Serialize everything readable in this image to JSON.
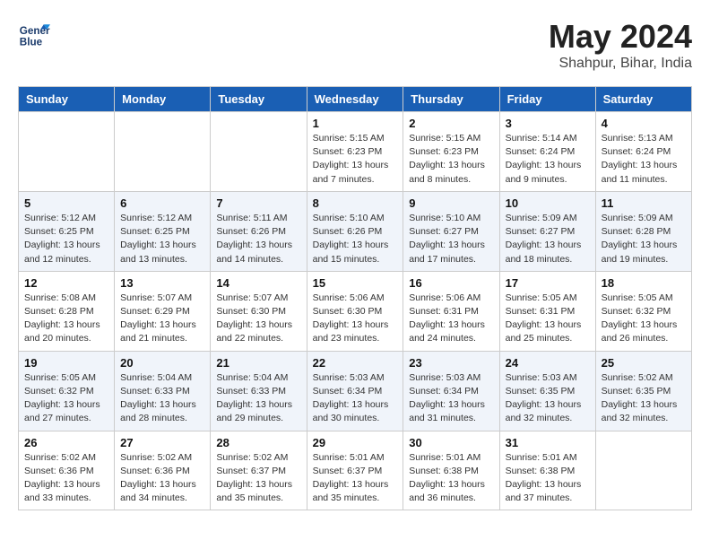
{
  "header": {
    "logo_line1": "General",
    "logo_line2": "Blue",
    "month_title": "May 2024",
    "location": "Shahpur, Bihar, India"
  },
  "weekdays": [
    "Sunday",
    "Monday",
    "Tuesday",
    "Wednesday",
    "Thursday",
    "Friday",
    "Saturday"
  ],
  "weeks": [
    [
      {
        "day": "",
        "info": ""
      },
      {
        "day": "",
        "info": ""
      },
      {
        "day": "",
        "info": ""
      },
      {
        "day": "1",
        "info": "Sunrise: 5:15 AM\nSunset: 6:23 PM\nDaylight: 13 hours\nand 7 minutes."
      },
      {
        "day": "2",
        "info": "Sunrise: 5:15 AM\nSunset: 6:23 PM\nDaylight: 13 hours\nand 8 minutes."
      },
      {
        "day": "3",
        "info": "Sunrise: 5:14 AM\nSunset: 6:24 PM\nDaylight: 13 hours\nand 9 minutes."
      },
      {
        "day": "4",
        "info": "Sunrise: 5:13 AM\nSunset: 6:24 PM\nDaylight: 13 hours\nand 11 minutes."
      }
    ],
    [
      {
        "day": "5",
        "info": "Sunrise: 5:12 AM\nSunset: 6:25 PM\nDaylight: 13 hours\nand 12 minutes."
      },
      {
        "day": "6",
        "info": "Sunrise: 5:12 AM\nSunset: 6:25 PM\nDaylight: 13 hours\nand 13 minutes."
      },
      {
        "day": "7",
        "info": "Sunrise: 5:11 AM\nSunset: 6:26 PM\nDaylight: 13 hours\nand 14 minutes."
      },
      {
        "day": "8",
        "info": "Sunrise: 5:10 AM\nSunset: 6:26 PM\nDaylight: 13 hours\nand 15 minutes."
      },
      {
        "day": "9",
        "info": "Sunrise: 5:10 AM\nSunset: 6:27 PM\nDaylight: 13 hours\nand 17 minutes."
      },
      {
        "day": "10",
        "info": "Sunrise: 5:09 AM\nSunset: 6:27 PM\nDaylight: 13 hours\nand 18 minutes."
      },
      {
        "day": "11",
        "info": "Sunrise: 5:09 AM\nSunset: 6:28 PM\nDaylight: 13 hours\nand 19 minutes."
      }
    ],
    [
      {
        "day": "12",
        "info": "Sunrise: 5:08 AM\nSunset: 6:28 PM\nDaylight: 13 hours\nand 20 minutes."
      },
      {
        "day": "13",
        "info": "Sunrise: 5:07 AM\nSunset: 6:29 PM\nDaylight: 13 hours\nand 21 minutes."
      },
      {
        "day": "14",
        "info": "Sunrise: 5:07 AM\nSunset: 6:30 PM\nDaylight: 13 hours\nand 22 minutes."
      },
      {
        "day": "15",
        "info": "Sunrise: 5:06 AM\nSunset: 6:30 PM\nDaylight: 13 hours\nand 23 minutes."
      },
      {
        "day": "16",
        "info": "Sunrise: 5:06 AM\nSunset: 6:31 PM\nDaylight: 13 hours\nand 24 minutes."
      },
      {
        "day": "17",
        "info": "Sunrise: 5:05 AM\nSunset: 6:31 PM\nDaylight: 13 hours\nand 25 minutes."
      },
      {
        "day": "18",
        "info": "Sunrise: 5:05 AM\nSunset: 6:32 PM\nDaylight: 13 hours\nand 26 minutes."
      }
    ],
    [
      {
        "day": "19",
        "info": "Sunrise: 5:05 AM\nSunset: 6:32 PM\nDaylight: 13 hours\nand 27 minutes."
      },
      {
        "day": "20",
        "info": "Sunrise: 5:04 AM\nSunset: 6:33 PM\nDaylight: 13 hours\nand 28 minutes."
      },
      {
        "day": "21",
        "info": "Sunrise: 5:04 AM\nSunset: 6:33 PM\nDaylight: 13 hours\nand 29 minutes."
      },
      {
        "day": "22",
        "info": "Sunrise: 5:03 AM\nSunset: 6:34 PM\nDaylight: 13 hours\nand 30 minutes."
      },
      {
        "day": "23",
        "info": "Sunrise: 5:03 AM\nSunset: 6:34 PM\nDaylight: 13 hours\nand 31 minutes."
      },
      {
        "day": "24",
        "info": "Sunrise: 5:03 AM\nSunset: 6:35 PM\nDaylight: 13 hours\nand 32 minutes."
      },
      {
        "day": "25",
        "info": "Sunrise: 5:02 AM\nSunset: 6:35 PM\nDaylight: 13 hours\nand 32 minutes."
      }
    ],
    [
      {
        "day": "26",
        "info": "Sunrise: 5:02 AM\nSunset: 6:36 PM\nDaylight: 13 hours\nand 33 minutes."
      },
      {
        "day": "27",
        "info": "Sunrise: 5:02 AM\nSunset: 6:36 PM\nDaylight: 13 hours\nand 34 minutes."
      },
      {
        "day": "28",
        "info": "Sunrise: 5:02 AM\nSunset: 6:37 PM\nDaylight: 13 hours\nand 35 minutes."
      },
      {
        "day": "29",
        "info": "Sunrise: 5:01 AM\nSunset: 6:37 PM\nDaylight: 13 hours\nand 35 minutes."
      },
      {
        "day": "30",
        "info": "Sunrise: 5:01 AM\nSunset: 6:38 PM\nDaylight: 13 hours\nand 36 minutes."
      },
      {
        "day": "31",
        "info": "Sunrise: 5:01 AM\nSunset: 6:38 PM\nDaylight: 13 hours\nand 37 minutes."
      },
      {
        "day": "",
        "info": ""
      }
    ]
  ]
}
